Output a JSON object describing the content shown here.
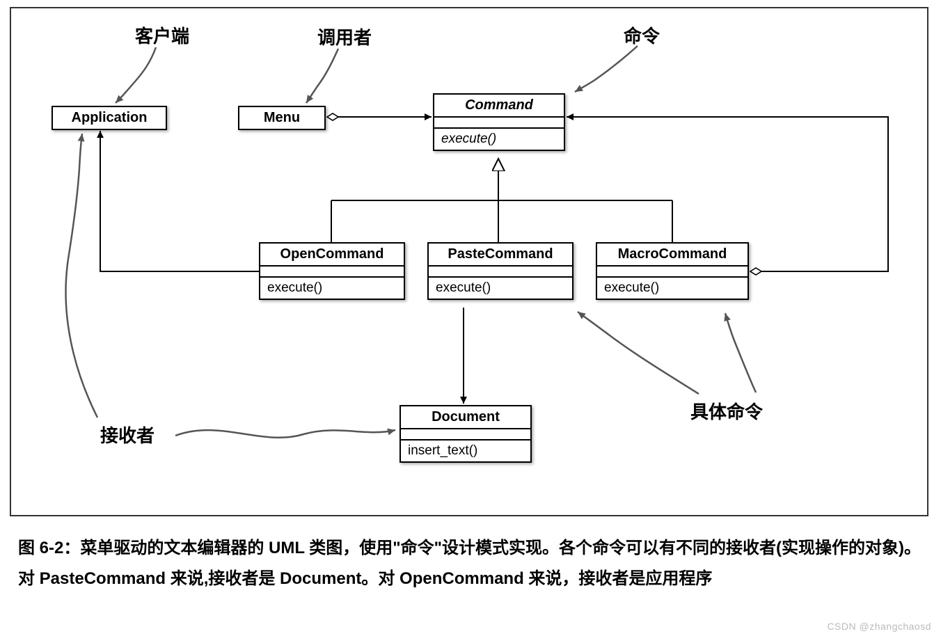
{
  "annotations": {
    "client": "客户端",
    "invoker": "调用者",
    "command": "命令",
    "receiver": "接收者",
    "concrete": "具体命令"
  },
  "classes": {
    "application": {
      "name": "Application"
    },
    "menu": {
      "name": "Menu"
    },
    "command": {
      "name": "Command",
      "op": "execute()"
    },
    "open": {
      "name": "OpenCommand",
      "op": "execute()"
    },
    "paste": {
      "name": "PasteCommand",
      "op": "execute()"
    },
    "macro": {
      "name": "MacroCommand",
      "op": "execute()"
    },
    "document": {
      "name": "Document",
      "op": "insert_text()"
    }
  },
  "caption": {
    "figno": "图 6-2：",
    "text": "菜单驱动的文本编辑器的 UML 类图，使用\"命令\"设计模式实现。各个命令可以有不同的接收者(实现操作的对象)。对 PasteCommand 来说,接收者是 Document。对 OpenCommand 来说，接收者是应用程序"
  },
  "watermark": "CSDN @zhangchaosd"
}
